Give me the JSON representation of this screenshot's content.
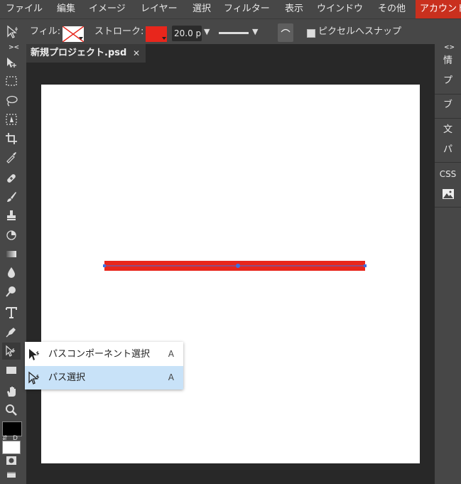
{
  "menu": {
    "items": [
      "ファイル",
      "編集",
      "イメージ",
      "レイヤー",
      "選択",
      "フィルター",
      "表示",
      "ウインドウ",
      "その他"
    ],
    "account": "アカウント"
  },
  "options": {
    "fill_label": "フィル:",
    "stroke_label": "ストローク:",
    "stroke_width": "20.0 p",
    "snap_label": "ピクセルへスナップ",
    "stroke_color": "#e8261c"
  },
  "collapse_left": "><",
  "collapse_right": "<>",
  "tab": {
    "name": "新規プロジェクト.psd",
    "close": "✕"
  },
  "right_panel": {
    "items": [
      "情",
      "プ",
      "ブ",
      "文",
      "パ",
      "CSS"
    ]
  },
  "tools": {
    "fg_color": "#000000",
    "bg_color": "#ffffff",
    "swap_label": "⇵",
    "default_label": "D"
  },
  "popup": {
    "items": [
      {
        "label": "パスコンポーネント選択",
        "shortcut": "A"
      },
      {
        "label": "パス選択",
        "shortcut": "A"
      }
    ],
    "selected_index": 1
  },
  "canvas": {
    "line_color": "#e8261c",
    "path_color": "#3d6fe0"
  }
}
